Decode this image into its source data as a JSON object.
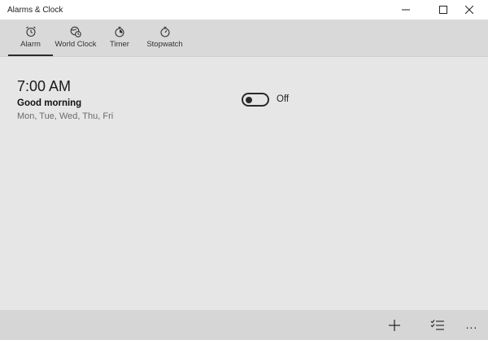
{
  "window": {
    "title": "Alarms & Clock",
    "controls": {
      "minimize_icon": "minimize-icon",
      "maximize_icon": "maximize-icon",
      "close_icon": "close-icon"
    }
  },
  "tabs": [
    {
      "label": "Alarm",
      "icon": "alarm-clock-icon",
      "selected": true
    },
    {
      "label": "World Clock",
      "icon": "globe-clock-icon",
      "selected": false
    },
    {
      "label": "Timer",
      "icon": "timer-icon",
      "selected": false
    },
    {
      "label": "Stopwatch",
      "icon": "stopwatch-icon",
      "selected": false
    }
  ],
  "alarms": [
    {
      "time": "7:00 AM",
      "name": "Good morning",
      "days": "Mon, Tue, Wed, Thu, Fri",
      "enabled": false,
      "toggle_label": "Off"
    }
  ],
  "bottom_bar": {
    "add_icon": "add-icon",
    "select_icon": "select-multiple-icon",
    "more_label": "..."
  },
  "colors": {
    "tab_bar": "#d9d9d9",
    "content_bg": "#e6e6e6",
    "bottom_bar": "#d6d6d6",
    "accent": "#2b2b2b"
  }
}
